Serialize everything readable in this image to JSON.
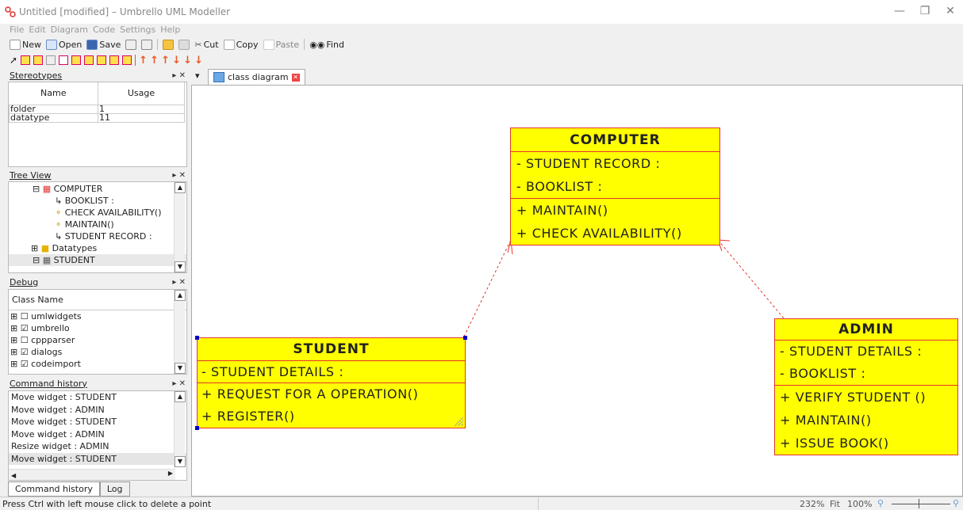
{
  "window": {
    "title": "Untitled [modified] – Umbrello UML Modeller"
  },
  "menu": [
    "File",
    "Edit",
    "Diagram",
    "Code",
    "Settings",
    "Help"
  ],
  "toolbar": {
    "new": "New",
    "open": "Open",
    "save": "Save",
    "cut": "Cut",
    "copy": "Copy",
    "paste": "Paste",
    "find": "Find"
  },
  "stereotypes": {
    "title": "Stereotypes",
    "columns": [
      "Name",
      "Usage"
    ],
    "rows": [
      [
        "folder",
        "1"
      ],
      [
        "datatype",
        "11"
      ]
    ]
  },
  "tree_view": {
    "title": "Tree View",
    "items": [
      "COMPUTER",
      "BOOKLIST :",
      "CHECK AVAILABILITY()",
      "MAINTAIN()",
      "STUDENT RECORD :",
      "Datatypes",
      "STUDENT"
    ]
  },
  "debug": {
    "title": "Debug",
    "column": "Class Name",
    "items": [
      {
        "label": "umlwidgets",
        "checked": false
      },
      {
        "label": "umbrello",
        "checked": true
      },
      {
        "label": "cppparser",
        "checked": false
      },
      {
        "label": "dialogs",
        "checked": true
      },
      {
        "label": "codeimport",
        "checked": true
      }
    ]
  },
  "command_history": {
    "title": "Command history",
    "items": [
      "Move widget : STUDENT",
      "Move widget : ADMIN",
      "Move widget : STUDENT",
      "Move widget : ADMIN",
      "Resize widget : ADMIN",
      "Move widget : STUDENT"
    ],
    "tabs": [
      "Command history",
      "Log"
    ]
  },
  "diagram_tab": {
    "label": "class diagram"
  },
  "classes": {
    "computer": {
      "name": "COMPUTER",
      "attributes": [
        "- STUDENT RECORD :",
        "- BOOKLIST :"
      ],
      "operations": [
        "+ MAINTAIN()",
        "+ CHECK AVAILABILITY()"
      ]
    },
    "student": {
      "name": "STUDENT",
      "attributes": [
        "- STUDENT DETAILS :"
      ],
      "operations": [
        "+ REQUEST FOR A OPERATION()",
        "+ REGISTER()"
      ]
    },
    "admin": {
      "name": "ADMIN",
      "attributes": [
        "- STUDENT DETAILS :",
        "- BOOKLIST :"
      ],
      "operations": [
        "+ VERIFY STUDENT ()",
        "+ MAINTAIN()",
        "+ ISSUE BOOK()"
      ]
    }
  },
  "status": {
    "message": "Press Ctrl with left mouse click to delete a point",
    "zoom_pct": "232%",
    "fit": "Fit",
    "hundred": "100%"
  },
  "colors": {
    "class_fill": "#ffff00",
    "class_border": "#e4352d"
  }
}
